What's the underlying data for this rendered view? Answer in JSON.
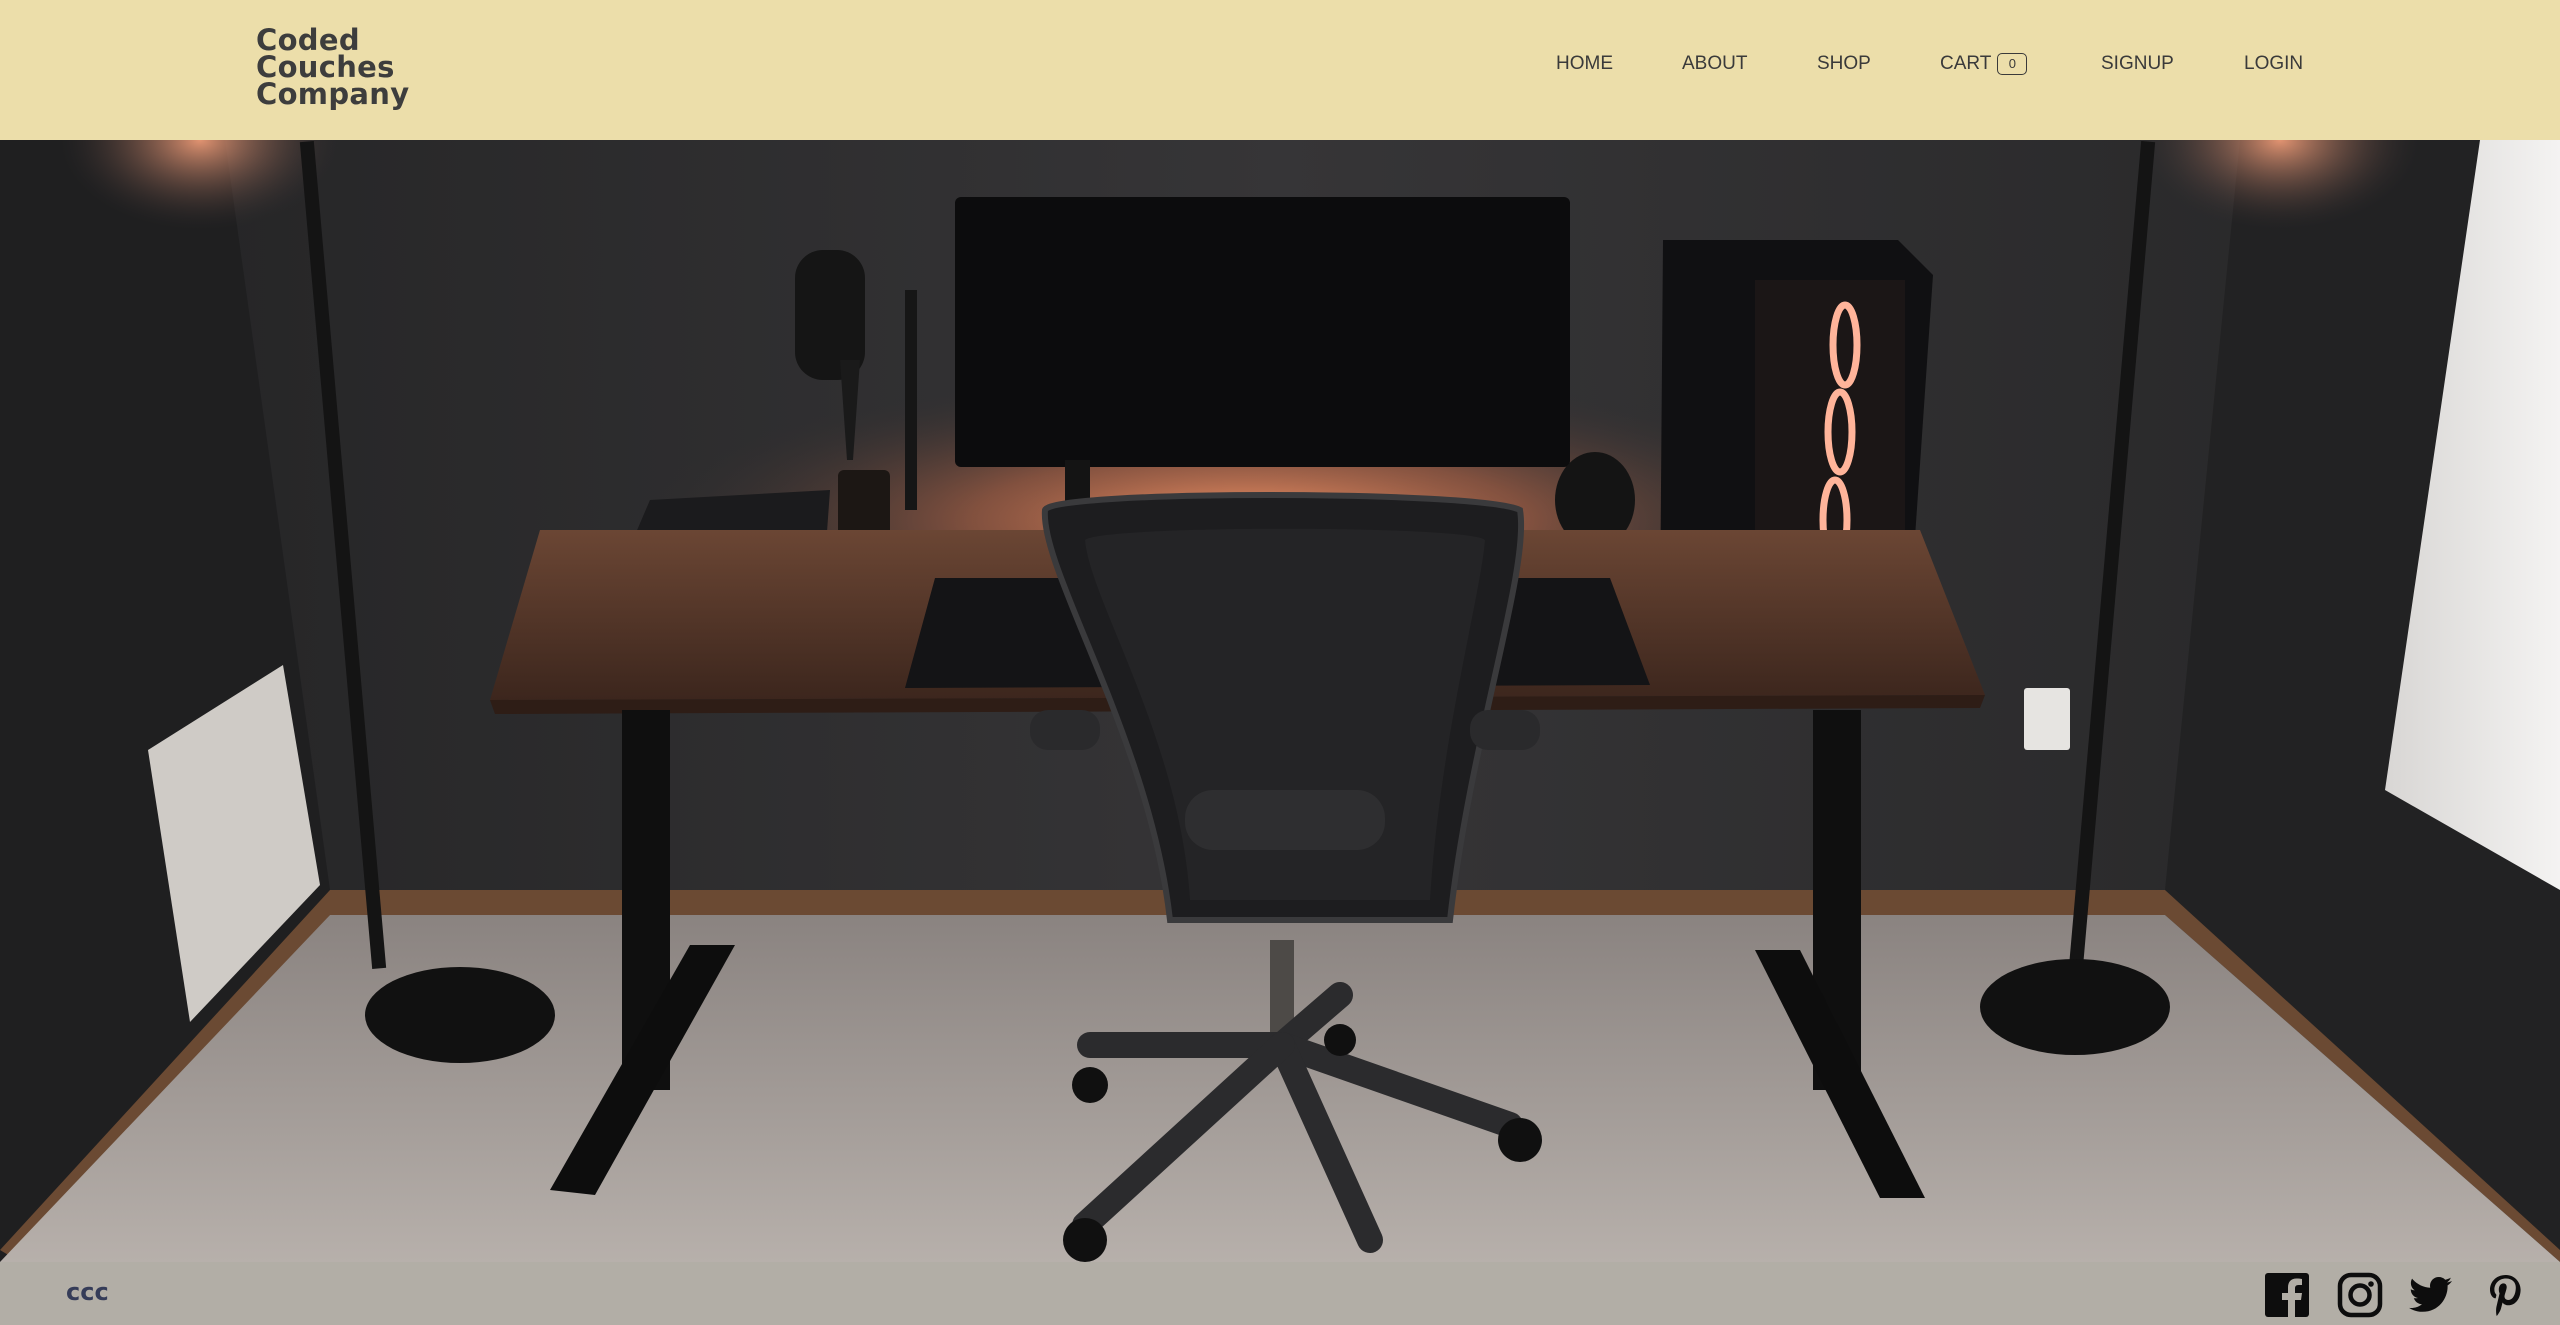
{
  "brand": {
    "line1": "Coded",
    "line2": "Couches",
    "line3": "Company"
  },
  "nav": {
    "home": "HOME",
    "about": "ABOUT",
    "shop": "SHOP",
    "cart": "CART",
    "cart_count": "0",
    "signup": "SIGNUP",
    "login": "LOGIN"
  },
  "hero": {
    "image": "desk-setup-photo"
  },
  "footer": {
    "text": "ccc",
    "social": [
      "facebook-icon",
      "instagram-icon",
      "twitter-icon",
      "pinterest-icon"
    ]
  },
  "colors": {
    "header_bg": "#ecdeaa",
    "footer_bg": "#b2aea6",
    "footer_text": "#353c58",
    "nav_text": "#3a3a3a"
  }
}
